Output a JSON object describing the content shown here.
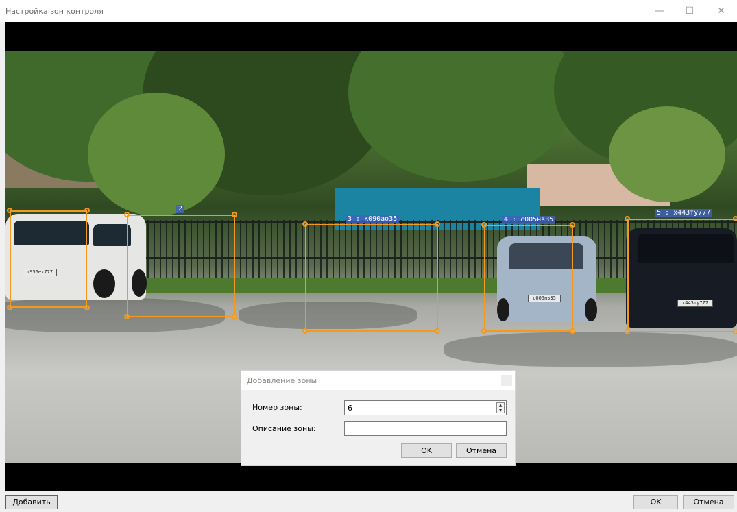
{
  "window": {
    "title": "Настройка зон контроля",
    "minimize_glyph": "—",
    "maximize_glyph": "☐",
    "close_glyph": "✕"
  },
  "zones": [
    {
      "label": "",
      "color": "#f39a1e"
    },
    {
      "label": "2",
      "color": "#f39a1e"
    },
    {
      "label": "3 : к090ао35",
      "color": "#f39a1e"
    },
    {
      "label": "4 : с005нв35",
      "color": "#f39a1e"
    },
    {
      "label": "5 : х443ту777",
      "color": "#f39a1e"
    }
  ],
  "plates": {
    "car1": "т956ех777",
    "car4": "с005нв35",
    "car5": "х443ту777"
  },
  "dialog": {
    "title": "Добавление зоны",
    "zone_number_label": "Номер зоны:",
    "zone_number_value": "6",
    "description_label": "Описание зоны:",
    "description_value": "",
    "ok": "OK",
    "cancel": "Отмена"
  },
  "footer": {
    "add": "Добавить",
    "ok": "OK",
    "cancel": "Отмена"
  },
  "colors": {
    "zone_border": "#f39a1e",
    "zone_label_bg": "#4060be",
    "focus_accent": "#0078d7"
  }
}
